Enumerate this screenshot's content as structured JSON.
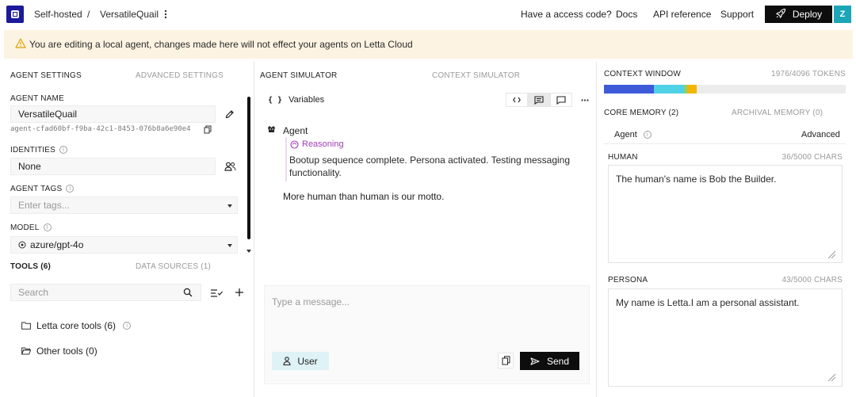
{
  "topbar": {
    "crumb_home": "Self-hosted",
    "crumb_sep": "/",
    "crumb_agent": "VersatileQuail",
    "menu_icon": "vertical-dots-icon",
    "nav": [
      "Have a access code?",
      "Docs",
      "API reference",
      "Support"
    ],
    "deploy_label": "Deploy",
    "avatar_initial": "Z"
  },
  "banner": {
    "text": "You are editing a local agent, changes made here will not effect your agents on Letta Cloud",
    "icon": "warning-icon",
    "color": "#fdf3e2"
  },
  "settings": {
    "tabs": [
      "AGENT SETTINGS",
      "ADVANCED SETTINGS"
    ],
    "agent_name_label": "AGENT NAME",
    "agent_name_value": "VersatileQuail",
    "agent_id": "agent-cfad60bf-f9ba-42c1-8453-076b8a6e90e4",
    "identities_label": "IDENTITIES",
    "identities_value": "None",
    "tags_label": "AGENT TAGS",
    "tags_placeholder": "Enter tags...",
    "model_label": "MODEL",
    "model_value": "azure/gpt-4o"
  },
  "tools": {
    "tabs": [
      "TOOLS (6)",
      "DATA SOURCES (1)"
    ],
    "search_placeholder": "Search",
    "groups": [
      "Letta core tools (6)",
      "Other tools (0)"
    ]
  },
  "simulator": {
    "tabs": [
      "AGENT SIMULATOR",
      "CONTEXT SIMULATOR"
    ],
    "variables_label": "Variables",
    "variables_glyph": "{ }",
    "agent_name": "Agent",
    "reasoning_label": "Reasoning",
    "reasoning_text": "Bootup sequence complete. Persona activated. Testing messaging functionality.",
    "reply_text": "More human than human is our motto.",
    "input_placeholder": "Type a message...",
    "role_label": "User",
    "send_label": "Send"
  },
  "context": {
    "title": "CONTEXT WINDOW",
    "tokens": "1976/4096 TOKENS",
    "bar_segments": [
      {
        "color": "#3d5bd9",
        "fraction": 0.205
      },
      {
        "color": "#4fd1e6",
        "fraction": 0.125
      },
      {
        "color": "#8bd16e",
        "fraction": 0.015
      },
      {
        "color": "#f2b600",
        "fraction": 0.04
      }
    ],
    "tabs": [
      "CORE MEMORY (2)",
      "ARCHIVAL MEMORY (0)"
    ],
    "subtabs": [
      "Agent",
      "Advanced"
    ],
    "human_label": "HUMAN",
    "human_chars": "36/5000 CHARS",
    "human_text": "The human's name is Bob the Builder.",
    "persona_label": "PERSONA",
    "persona_chars": "43/5000 CHARS",
    "persona_text": "My name is Letta.I am a personal assistant."
  },
  "colors": {
    "brand": "#1c1a9b",
    "reasoning": "#a03fb3",
    "deploy_bg": "#0d0d0d",
    "user_chip": "#dff2f5",
    "avatar": "#1aa6b7"
  }
}
